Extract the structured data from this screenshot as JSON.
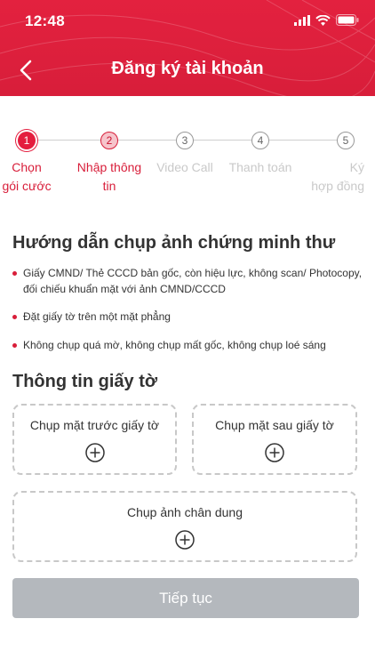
{
  "status_bar": {
    "time": "12:48"
  },
  "header": {
    "title": "Đăng ký tài khoản"
  },
  "stepper": {
    "steps": [
      {
        "number": "1",
        "label_line1": "Chọn",
        "label_line2": "gói cước"
      },
      {
        "number": "2",
        "label_line1": "Nhập thông",
        "label_line2": "tin"
      },
      {
        "number": "3",
        "label_line1": "Video Call",
        "label_line2": ""
      },
      {
        "number": "4",
        "label_line1": "Thanh toán",
        "label_line2": ""
      },
      {
        "number": "5",
        "label_line1": "Ký",
        "label_line2": "hợp đồng"
      }
    ]
  },
  "guide": {
    "title": "Hướng dẫn chụp ảnh chứng minh thư",
    "items": [
      "Giấy CMND/ Thẻ CCCD bản gốc, còn hiệu lực, không scan/ Photocopy, đối chiếu khuẩn mặt với ảnh CMND/CCCD",
      "Đặt giấy tờ trên một mặt phẳng",
      "Không chụp quá mờ, không chụp mất gốc, không chụp loé sáng"
    ]
  },
  "documents": {
    "title": "Thông tin giấy tờ",
    "front_label": "Chụp mặt trước giấy tờ",
    "back_label": "Chụp mặt sau giấy tờ",
    "portrait_label": "Chụp ảnh chân dung"
  },
  "continue_button": "Tiếp tục",
  "colors": {
    "brand": "#d81e3a",
    "button_disabled": "#b4b8bd"
  }
}
